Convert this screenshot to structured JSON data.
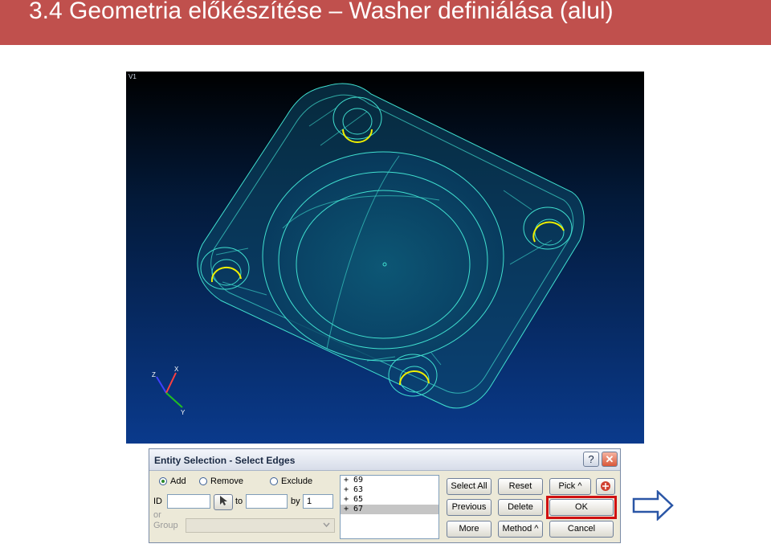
{
  "slide": {
    "title": "3.4 Geometria előkészítése – Washer definiálása (alul)"
  },
  "viewport": {
    "label": "V1",
    "axes": {
      "z": "Z",
      "x": "X",
      "y": "Y"
    }
  },
  "dialog": {
    "title": "Entity Selection - Select Edges",
    "help_button": "?",
    "close_button": "✕",
    "mode_options": [
      {
        "label": "Add",
        "selected": true
      },
      {
        "label": "Remove",
        "selected": false
      },
      {
        "label": "Exclude",
        "selected": false
      }
    ],
    "id_label": "ID",
    "id_value": "",
    "to_label": "to",
    "to_value": "",
    "by_label": "by",
    "by_value": "1",
    "or_label": "or",
    "group_label": "Group",
    "group_value": "",
    "list_items": [
      {
        "text": "+  69",
        "selected": false
      },
      {
        "text": "+  63",
        "selected": false
      },
      {
        "text": "+  65",
        "selected": false
      },
      {
        "text": "+  67",
        "selected": true
      }
    ],
    "buttons": {
      "select_all": "Select All",
      "reset": "Reset",
      "pick": "Pick ^",
      "previous": "Previous",
      "delete": "Delete",
      "ok": "OK",
      "more": "More",
      "method": "Method ^",
      "cancel": "Cancel"
    }
  },
  "colors": {
    "title_bar": "#c0504d",
    "wireframe": "#40e0d0",
    "highlight_edge": "#f0f000",
    "ok_highlight": "#d01010",
    "arrow": "#2a56a6"
  }
}
